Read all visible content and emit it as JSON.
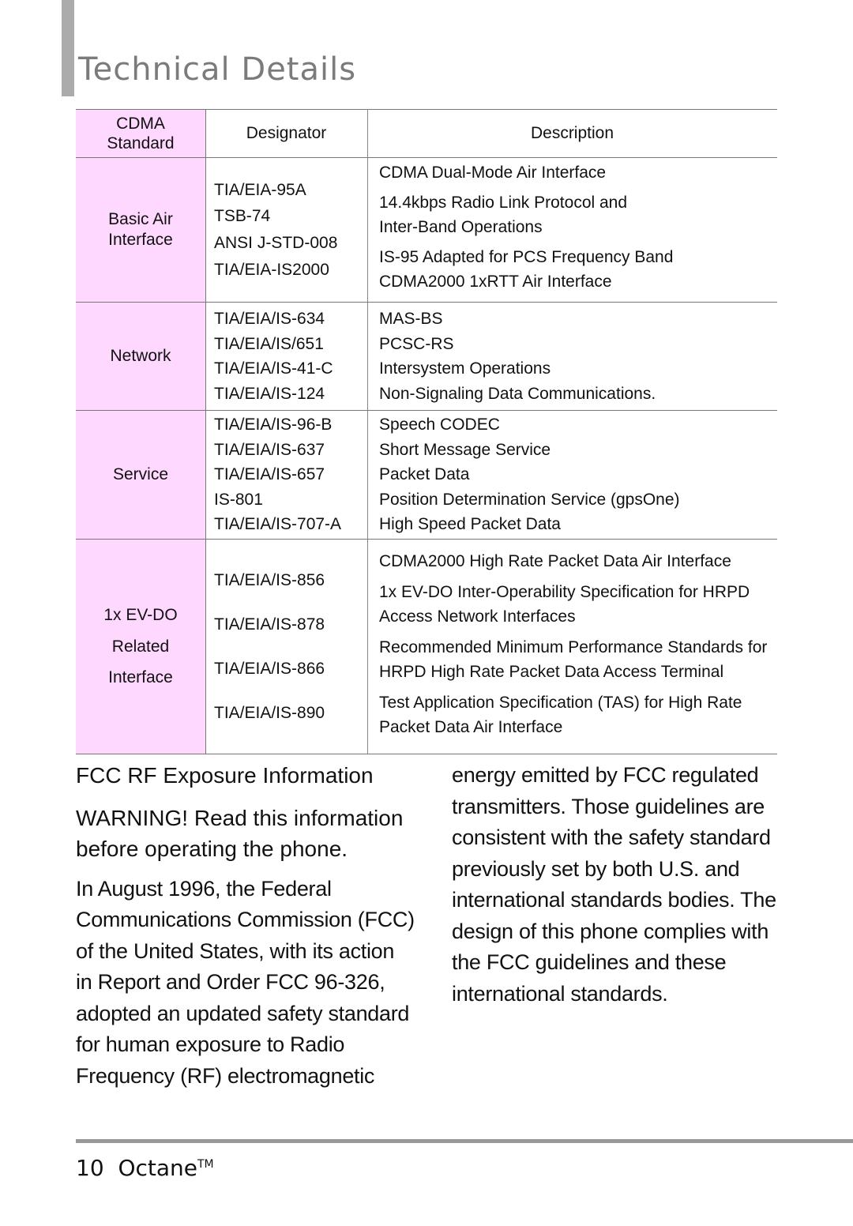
{
  "header": {
    "title": "Technical Details"
  },
  "table": {
    "columns": [
      "CDMA Standard",
      "Designator",
      "Description"
    ],
    "column_lines": {
      "standard": [
        "CDMA",
        "Standard"
      ]
    },
    "groups": [
      {
        "standard": [
          "Basic Air",
          "Interface"
        ],
        "designators": [
          "TIA/EIA-95A",
          "TSB-74",
          "ANSI J-STD-008",
          "TIA/EIA-IS2000"
        ],
        "descriptions": [
          "CDMA Dual-Mode Air Interface",
          "14.4kbps Radio Link Protocol and Inter-Band Operations",
          "IS-95 Adapted for PCS Frequency Band CDMA2000 1xRTT Air Interface"
        ],
        "description_lines": [
          [
            "CDMA Dual-Mode Air Interface"
          ],
          [
            "14.4kbps Radio Link Protocol and",
            "Inter-Band Operations"
          ],
          [
            "IS-95 Adapted for PCS Frequency Band",
            "CDMA2000 1xRTT Air Interface"
          ]
        ]
      },
      {
        "standard": [
          "Network"
        ],
        "designators": [
          "TIA/EIA/IS-634",
          "TIA/EIA/IS/651",
          "TIA/EIA/IS-41-C",
          "TIA/EIA/IS-124"
        ],
        "descriptions": [
          "MAS-BS",
          "PCSC-RS",
          "Intersystem Operations",
          "Non-Signaling Data Communications."
        ]
      },
      {
        "standard": [
          "Service"
        ],
        "designators": [
          "TIA/EIA/IS-96-B",
          "TIA/EIA/IS-637",
          "TIA/EIA/IS-657",
          "IS-801",
          "TIA/EIA/IS-707-A"
        ],
        "descriptions": [
          "Speech CODEC",
          "Short Message Service",
          "Packet Data",
          "Position Determination Service (gpsOne)",
          "High Speed Packet Data"
        ]
      },
      {
        "standard": [
          "1x EV-DO",
          "Related",
          "Interface"
        ],
        "designators": [
          "TIA/EIA/IS-856",
          "TIA/EIA/IS-878",
          "TIA/EIA/IS-866",
          "TIA/EIA/IS-890"
        ],
        "description_lines": [
          [
            "CDMA2000 High Rate Packet Data Air Interface"
          ],
          [
            "1x EV-DO Inter-Operability Specification for HRPD",
            "Access Network Interfaces"
          ],
          [
            "Recommended Minimum Performance Standards for",
            "HRPD High Rate Packet Data Access Terminal"
          ],
          [
            "Test Application Specification (TAS) for High Rate",
            "Packet Data Air Interface"
          ]
        ]
      }
    ]
  },
  "fcc": {
    "heading": "FCC RF Exposure Information",
    "warning_lines": [
      "WARNING! Read this information",
      "before operating the phone."
    ],
    "left_lines": [
      "In August 1996, the Federal",
      "Communications Commission (FCC)",
      "of the United States, with its action",
      "in Report and Order FCC 96-326,",
      "adopted an updated safety standard",
      "for human exposure to Radio",
      "Frequency (RF) electromagnetic"
    ],
    "right_lines": [
      "energy emitted by FCC regulated",
      "transmitters. Those guidelines are",
      "consistent with the safety standard",
      "previously set by both U.S. and",
      "international standards bodies. The",
      "design of this phone complies with",
      "the FCC guidelines and these",
      "international standards."
    ]
  },
  "footer": {
    "page_number": "10",
    "product": "Octane",
    "trademark": "TM"
  },
  "colors": {
    "standard_column_bg": "#ffd8ff",
    "title_gray": "#7b7b7b",
    "accent_bar": "#ababab"
  }
}
